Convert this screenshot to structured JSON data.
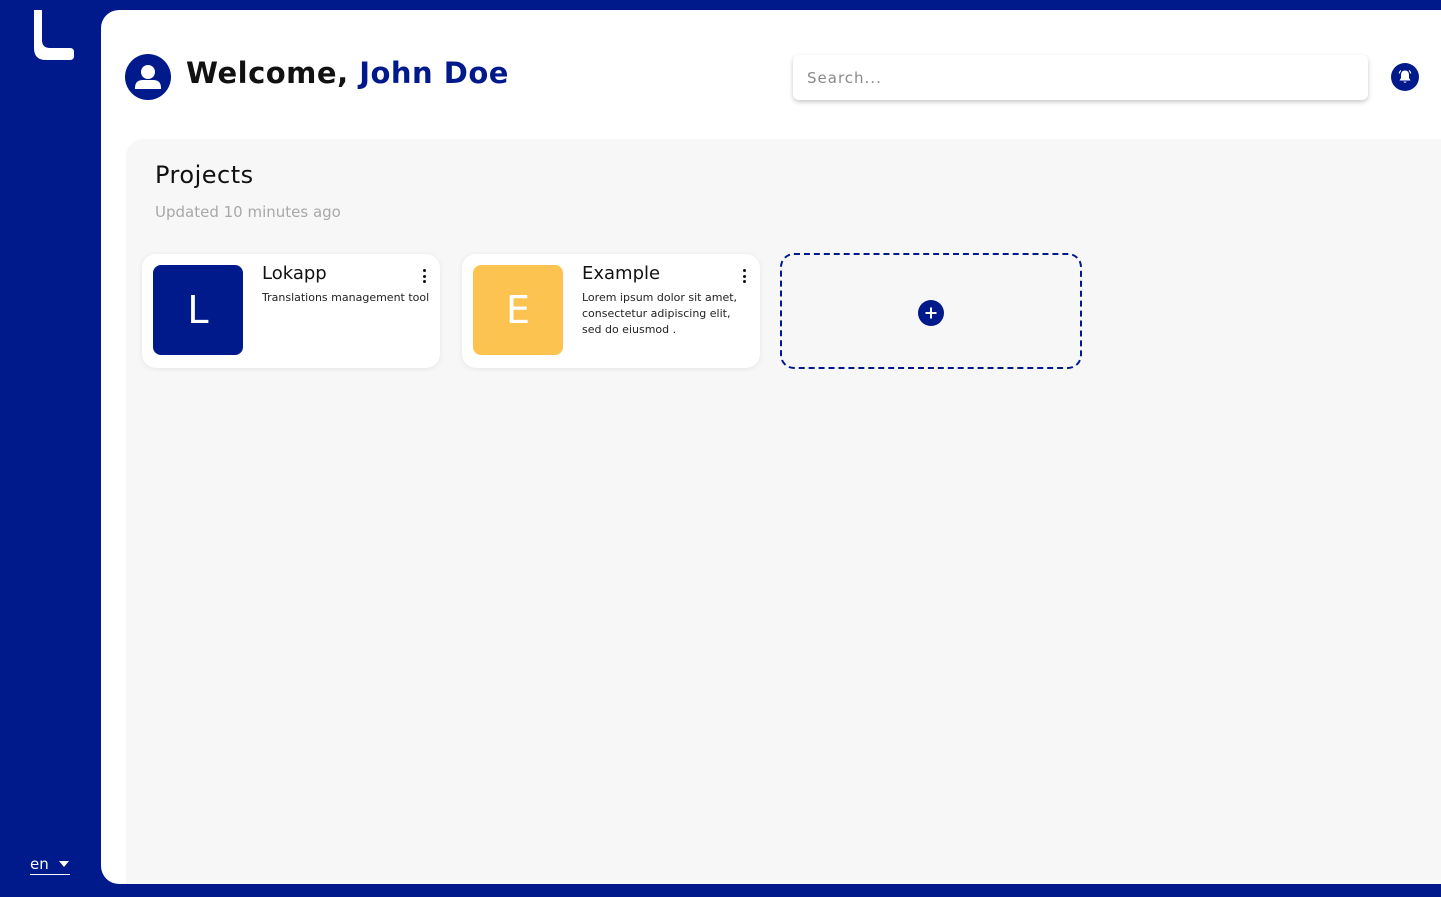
{
  "app": {
    "logo_icon": "app-logo-l"
  },
  "colors": {
    "primary": "#001a8c",
    "accent_yellow": "#fdc350",
    "surface": "#f8f7f8"
  },
  "language": {
    "selected": "en"
  },
  "header": {
    "greeting": "Welcome,",
    "user_name": "John Doe",
    "avatar_icon": "user-icon",
    "search_placeholder": "Search...",
    "notification_icon": "bell-icon"
  },
  "projects": {
    "title": "Projects",
    "updated": "Updated 10 minutes ago",
    "items": [
      {
        "initial": "L",
        "name": "Lokapp",
        "description": "Translations management tool",
        "color": "#001a8c"
      },
      {
        "initial": "E",
        "name": "Example",
        "description": "Lorem ipsum dolor sit amet, consectetur adipiscing elit, sed do eiusmod .",
        "color": "#fdc350"
      }
    ],
    "add_icon": "plus-circle-icon"
  }
}
